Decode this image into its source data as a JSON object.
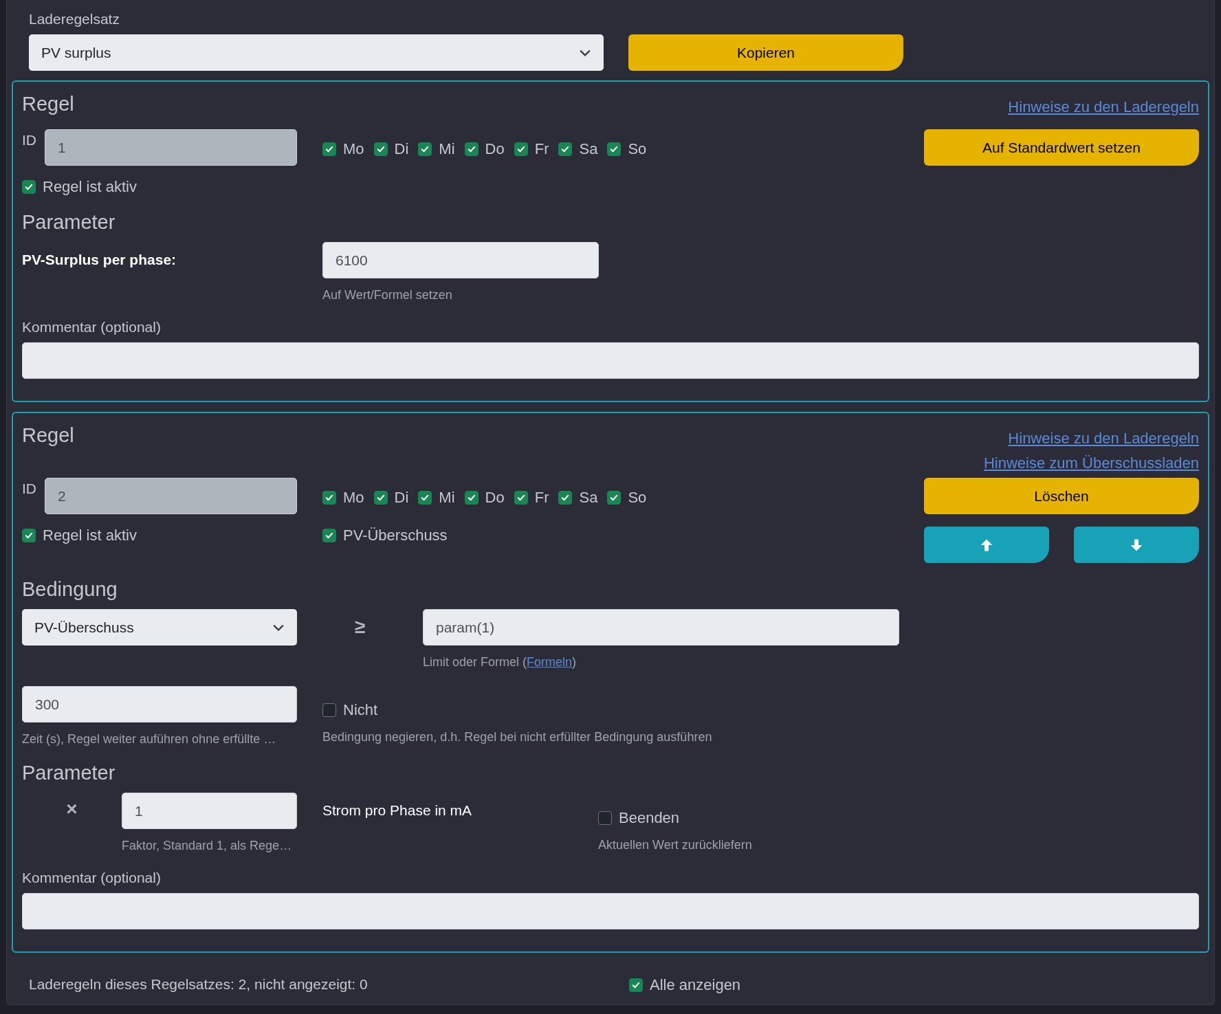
{
  "rule_set": {
    "label": "Laderegelsatz",
    "value": "PV surplus",
    "copy_button": "Kopieren"
  },
  "rules": [
    {
      "kind": "default",
      "heading": "Regel",
      "links": [
        "Hinweise zu den Laderegeln"
      ],
      "id_label": "ID",
      "id_value": "1",
      "days": [
        {
          "label": "Mo",
          "checked": true
        },
        {
          "label": "Di",
          "checked": true
        },
        {
          "label": "Mi",
          "checked": true
        },
        {
          "label": "Do",
          "checked": true
        },
        {
          "label": "Fr",
          "checked": true
        },
        {
          "label": "Sa",
          "checked": true
        },
        {
          "label": "So",
          "checked": true
        }
      ],
      "active": {
        "label": "Regel ist aktiv",
        "checked": true
      },
      "action_button": "Auf Standardwert setzen",
      "parameter_heading": "Parameter",
      "parameter": {
        "label": "PV-Surplus per phase:",
        "value": "6100",
        "hint": "Auf Wert/Formel setzen"
      },
      "comment_label": "Kommentar (optional)"
    },
    {
      "kind": "condition",
      "heading": "Regel",
      "links": [
        "Hinweise zu den Laderegeln",
        "Hinweise zum Überschussladen"
      ],
      "id_label": "ID",
      "id_value": "2",
      "days": [
        {
          "label": "Mo",
          "checked": true
        },
        {
          "label": "Di",
          "checked": true
        },
        {
          "label": "Mi",
          "checked": true
        },
        {
          "label": "Do",
          "checked": true
        },
        {
          "label": "Fr",
          "checked": true
        },
        {
          "label": "Sa",
          "checked": true
        },
        {
          "label": "So",
          "checked": true
        }
      ],
      "active": {
        "label": "Regel ist aktiv",
        "checked": true
      },
      "pv_surplus": {
        "label": "PV-Überschuss",
        "checked": true
      },
      "action_button": "Löschen",
      "condition_heading": "Bedingung",
      "condition_select": "PV-Überschuss",
      "operator": "≥",
      "limit_value": "param(1)",
      "limit_hint": {
        "prefix": "Limit oder Formel (",
        "link": "Formeln",
        "suffix": ")"
      },
      "time_value": "300",
      "time_hint": "Zeit (s), Regel weiter auführen ohne erfüllte …",
      "negate": {
        "label": "Nicht",
        "checked": false,
        "hint": "Bedingung negieren, d.h. Regel bei nicht erfüllter Bedingung ausführen"
      },
      "parameter_heading": "Parameter",
      "factor_operator": "×",
      "factor_value": "1",
      "factor_hint": "Faktor, Standard 1, als Rege…",
      "parameter_label": "Strom pro Phase in mA",
      "finish": {
        "label": "Beenden",
        "checked": false,
        "hint": "Aktuellen Wert zurückliefern"
      },
      "comment_label": "Kommentar (optional)"
    }
  ],
  "footer": {
    "summary": "Laderegeln dieses Regelsatzes: 2, nicht angezeigt: 0",
    "show_all": {
      "label": "Alle anzeigen",
      "checked": true
    }
  }
}
